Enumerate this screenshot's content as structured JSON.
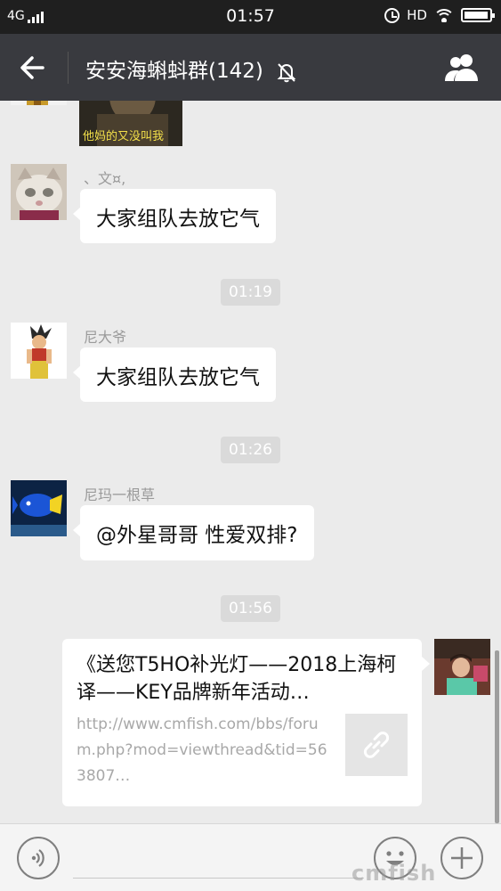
{
  "status_bar": {
    "network": "4G",
    "time": "01:57",
    "hd": "HD",
    "battery_fraction": 0.95
  },
  "header": {
    "title": "安安海蝌蚪群(142)",
    "back_icon": "arrow-left-icon",
    "mute_icon": "bell-off-icon",
    "members_icon": "group-members-icon"
  },
  "messages": [
    {
      "type": "image",
      "sender": "",
      "caption": "他妈的又没叫我"
    },
    {
      "type": "text",
      "sender": "、文¤,",
      "text": "大家组队去放它气"
    },
    {
      "type": "time",
      "text": "01:19"
    },
    {
      "type": "text",
      "sender": "尼大爷",
      "text": "大家组队去放它气"
    },
    {
      "type": "time",
      "text": "01:26"
    },
    {
      "type": "text",
      "sender": "尼玛一根草",
      "text": "@外星哥哥 性爱双排?"
    },
    {
      "type": "time",
      "text": "01:56"
    },
    {
      "type": "link",
      "sender": "me",
      "title": "《送您T5HO补光灯——2018上海柯译——KEY品牌新年活动…",
      "url": "http://www.cmfish.com/bbs/forum.php?mod=viewthread&tid=563807…",
      "thumb_icon": "link-icon"
    }
  ],
  "input_bar": {
    "voice_icon": "voice-icon",
    "emoji_icon": "emoji-icon",
    "add_icon": "plus-icon"
  },
  "watermark": "cmfish"
}
